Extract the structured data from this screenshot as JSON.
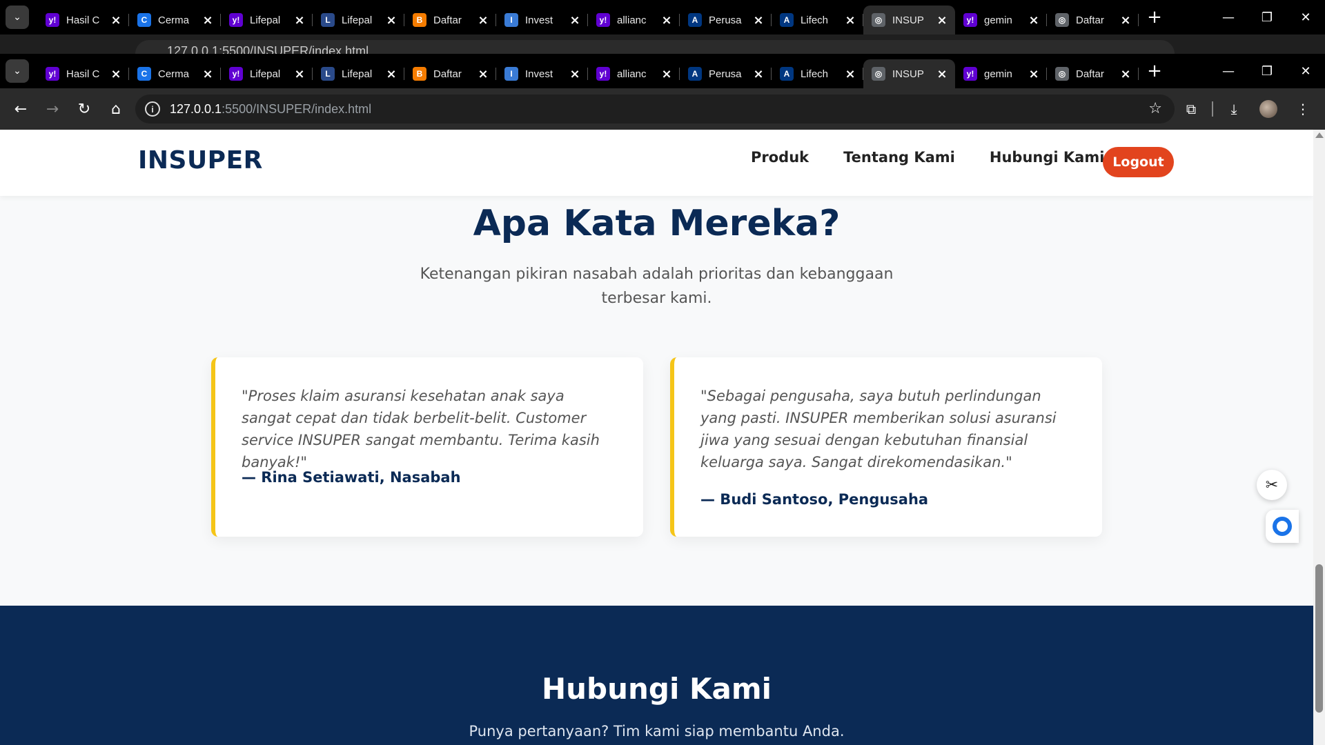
{
  "browser": {
    "tabs": [
      {
        "title": "Hasil C",
        "icon": "yahoo-icon",
        "color": "#6001d2",
        "glyph": "y!"
      },
      {
        "title": "Cerma",
        "icon": "cermati-icon",
        "color": "#1a73e8",
        "glyph": "C"
      },
      {
        "title": "Lifepal",
        "icon": "yahoo-icon",
        "color": "#6001d2",
        "glyph": "y!"
      },
      {
        "title": "Lifepal",
        "icon": "lifepal-icon",
        "color": "#2a4a8a",
        "glyph": "L"
      },
      {
        "title": "Daftar",
        "icon": "blogger-icon",
        "color": "#f57c00",
        "glyph": "B"
      },
      {
        "title": "Invest",
        "icon": "invest-icon",
        "color": "#3a7bd5",
        "glyph": "I"
      },
      {
        "title": "allianc",
        "icon": "yahoo-icon",
        "color": "#6001d2",
        "glyph": "y!"
      },
      {
        "title": "Perusa",
        "icon": "allianz-icon",
        "color": "#003781",
        "glyph": "A"
      },
      {
        "title": "Lifech",
        "icon": "allianz-icon",
        "color": "#003781",
        "glyph": "A"
      },
      {
        "title": "INSUP",
        "icon": "globe-icon",
        "color": "#5f6368",
        "glyph": "◎",
        "active": true
      },
      {
        "title": "gemin",
        "icon": "yahoo-icon",
        "color": "#6001d2",
        "glyph": "y!"
      },
      {
        "title": "Daftar",
        "icon": "globe-icon",
        "color": "#5f6368",
        "glyph": "◎"
      }
    ],
    "url_host": "127.0.0.1",
    "url_path": ":5500/INSUPER/index.html"
  },
  "nav": {
    "brand": "INSUPER",
    "links": [
      "Produk",
      "Tentang Kami",
      "Hubungi Kami"
    ],
    "logout": "Logout"
  },
  "testimonials": {
    "title": "Apa Kata Mereka?",
    "subtitle": "Ketenangan pikiran nasabah adalah prioritas dan kebanggaan terbesar kami.",
    "items": [
      {
        "quote": "\"Proses klaim asuransi kesehatan anak saya sangat cepat dan tidak berbelit-belit. Customer service INSUPER sangat membantu. Terima kasih banyak!\"",
        "author": "— Rina Setiawati, Nasabah"
      },
      {
        "quote": "\"Sebagai pengusaha, saya butuh perlindungan yang pasti. INSUPER memberikan solusi asuransi jiwa yang sesuai dengan kebutuhan finansial keluarga saya. Sangat direkomendasikan.\"",
        "author": "— Budi Santoso, Pengusaha"
      }
    ]
  },
  "contact": {
    "title": "Hubungi Kami",
    "subtitle": "Punya pertanyaan? Tim kami siap membantu Anda."
  },
  "colors": {
    "navy": "#0b2a55",
    "accent": "#e2441e",
    "card_border": "#f5c518"
  }
}
